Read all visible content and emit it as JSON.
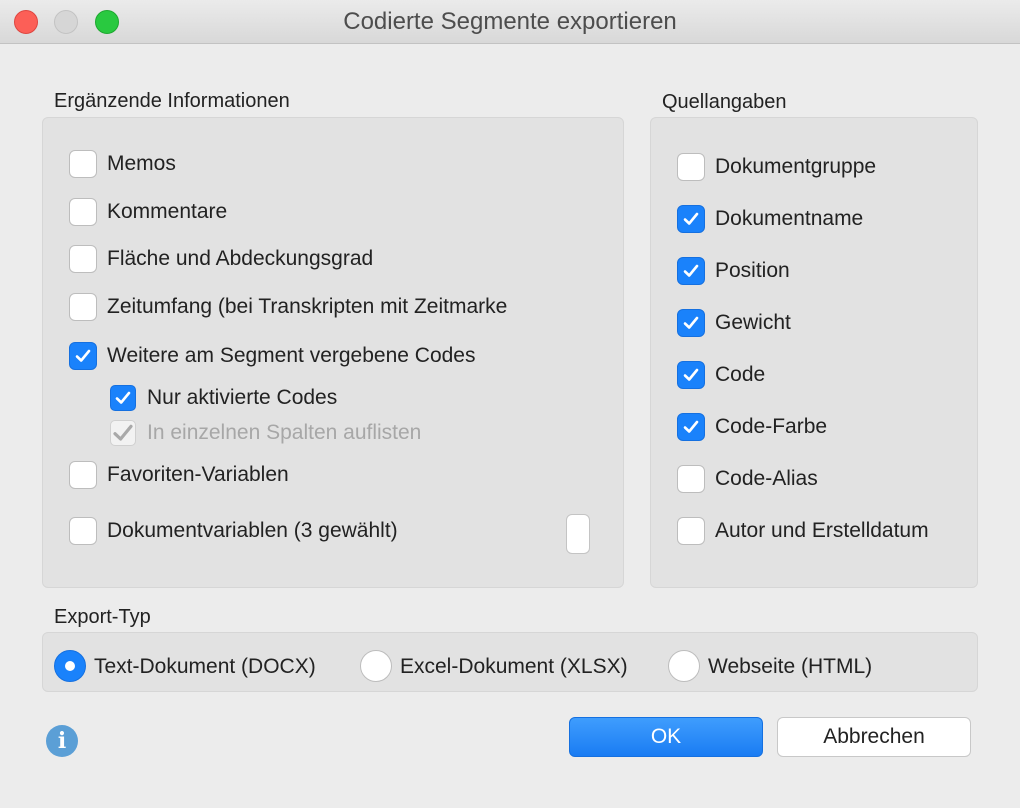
{
  "window": {
    "title": "Codierte Segmente exportieren"
  },
  "supplementary": {
    "heading": "Ergänzende Informationen",
    "items": [
      {
        "label": "Memos",
        "checked": false
      },
      {
        "label": "Kommentare",
        "checked": false
      },
      {
        "label": "Fläche und Abdeckungsgrad",
        "checked": false
      },
      {
        "label": "Zeitumfang (bei Transkripten mit Zeitmarke",
        "checked": false
      },
      {
        "label": "Weitere am Segment vergebene Codes",
        "checked": true
      },
      {
        "label": "Nur aktivierte Codes",
        "checked": true
      },
      {
        "label": "In einzelnen Spalten auflisten",
        "checked": true,
        "disabled": true
      },
      {
        "label": "Favoriten-Variablen",
        "checked": false
      },
      {
        "label": "Dokumentvariablen (3 gewählt)",
        "checked": false
      }
    ]
  },
  "sources": {
    "heading": "Quellangaben",
    "items": [
      {
        "label": "Dokumentgruppe",
        "checked": false
      },
      {
        "label": "Dokumentname",
        "checked": true
      },
      {
        "label": "Position",
        "checked": true
      },
      {
        "label": "Gewicht",
        "checked": true
      },
      {
        "label": "Code",
        "checked": true
      },
      {
        "label": "Code-Farbe",
        "checked": true
      },
      {
        "label": "Code-Alias",
        "checked": false
      },
      {
        "label": "Autor und Erstelldatum",
        "checked": false
      }
    ]
  },
  "export_type": {
    "heading": "Export-Typ",
    "options": [
      {
        "label": "Text-Dokument (DOCX)",
        "selected": true
      },
      {
        "label": "Excel-Dokument (XLSX)",
        "selected": false
      },
      {
        "label": "Webseite (HTML)",
        "selected": false
      }
    ]
  },
  "buttons": {
    "ok": "OK",
    "cancel": "Abbrechen"
  },
  "colors": {
    "accent": "#1a82fb",
    "close": "#fc5f57",
    "maximize": "#29c940",
    "info": "#5b9fd6"
  }
}
